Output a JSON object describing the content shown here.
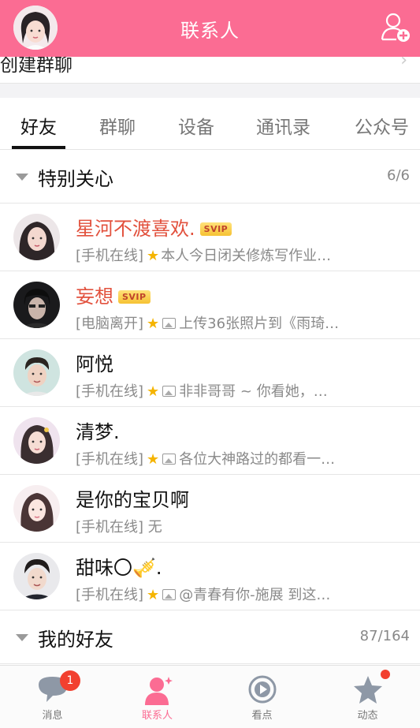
{
  "header": {
    "title": "联系人",
    "avatar_icon": "user-avatar",
    "add_icon": "add-contact-icon"
  },
  "create_group": {
    "label": "创建群聊",
    "chevron": "›"
  },
  "tabs": [
    "好友",
    "群聊",
    "设备",
    "通讯录",
    "公众号"
  ],
  "active_tab": "好友",
  "groups": {
    "special": {
      "name": "特别关心",
      "count": "6/6"
    },
    "friends": {
      "name": "我的好友",
      "count": "87/164"
    }
  },
  "contacts": [
    {
      "name": "星河不渡喜欢.",
      "vip": true,
      "badge": "SVIP",
      "status": "[手机在线]",
      "star": "★",
      "has_image": false,
      "message": "本人今日闭关修炼写作业…"
    },
    {
      "name": "妄想",
      "vip": true,
      "badge": "SVIP",
      "status": "[电脑离开]",
      "star": "★",
      "has_image": true,
      "message": "上传36张照片到《雨琦…"
    },
    {
      "name": "阿悦",
      "vip": false,
      "badge": "",
      "status": "[手机在线]",
      "star": "★",
      "has_image": true,
      "message": "非非哥哥 ~ 你看她，…"
    },
    {
      "name": "清梦.",
      "vip": false,
      "badge": "",
      "status": "[手机在线]",
      "star": "★",
      "has_image": true,
      "message": "各位大神路过的都看一…"
    },
    {
      "name": "是你的宝贝啊",
      "vip": false,
      "badge": "",
      "status": "[手机在线]",
      "star": "",
      "has_image": false,
      "message": "无"
    },
    {
      "name": "甜味〇🎺.",
      "vip": false,
      "badge": "",
      "status": "[手机在线]",
      "star": "★",
      "has_image": true,
      "message": "@青春有你-施展 到这…"
    }
  ],
  "bottom_nav": [
    {
      "label": "消息",
      "icon": "message-icon",
      "badge": "1"
    },
    {
      "label": "联系人",
      "icon": "contacts-icon",
      "active": true
    },
    {
      "label": "看点",
      "icon": "play-icon"
    },
    {
      "label": "动态",
      "icon": "star-icon",
      "dot": true
    }
  ],
  "colors": {
    "brand": "#fb6c93",
    "vip_name": "#e2513d",
    "badge_red": "#f2402f",
    "star": "#f5b400"
  }
}
